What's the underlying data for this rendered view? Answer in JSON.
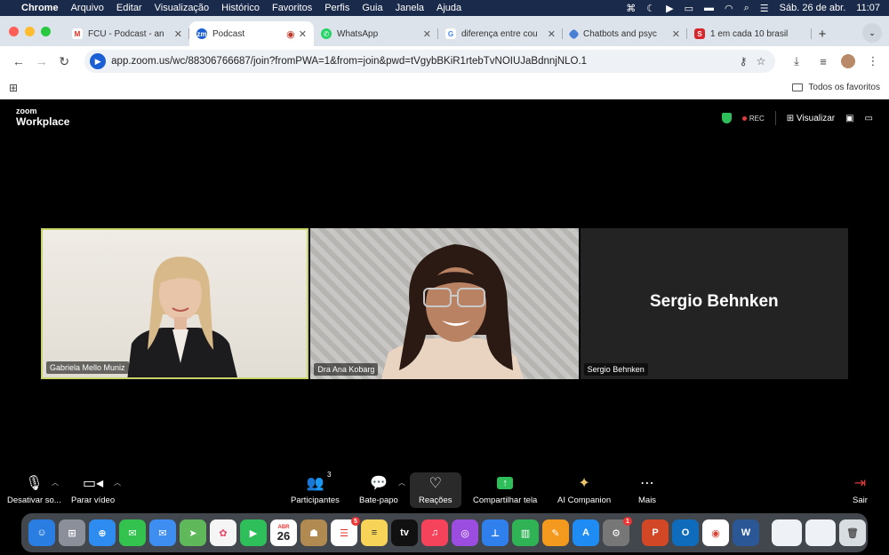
{
  "menubar": {
    "app": "Chrome",
    "items": [
      "Arquivo",
      "Editar",
      "Visualização",
      "Histórico",
      "Favoritos",
      "Perfis",
      "Guia",
      "Janela",
      "Ajuda"
    ],
    "date": "Sáb. 26 de abr.",
    "time": "11:07"
  },
  "tabs": [
    {
      "label": "FCU - Podcast - an",
      "favicon": "gmail-icon",
      "color": "#d93025",
      "active": false
    },
    {
      "label": "Podcast",
      "favicon": "zoom-icon",
      "color": "#1a5fd6",
      "active": true
    },
    {
      "label": "WhatsApp",
      "favicon": "whatsapp-icon",
      "color": "#25d366",
      "active": false
    },
    {
      "label": "diferença entre cou",
      "favicon": "google-icon",
      "color": "#4285f4",
      "active": false
    },
    {
      "label": "Chatbots and psyc",
      "favicon": "site-icon",
      "color": "#4a7fd6",
      "active": false
    },
    {
      "label": "1 em cada 10 brasil",
      "favicon": "site-icon",
      "color": "#d9262c",
      "active": false
    }
  ],
  "address": {
    "url": "app.zoom.us/wc/88306766687/join?fromPWA=1&from=join&pwd=tVgybBKiR1rtebTvNOIUJaBdnnjNLO.1"
  },
  "bookmarks": {
    "all_favorites": "Todos os favoritos"
  },
  "zoom": {
    "logo_top": "zoom",
    "logo_bottom": "Workplace",
    "rec": "REC",
    "view": "Visualizar"
  },
  "participants": [
    {
      "name": "Gabriela Mello Muniz"
    },
    {
      "name": "Dra Ana Kobarg"
    },
    {
      "name": "Sergio Behnken",
      "display": "Sergio Behnken"
    }
  ],
  "controls": {
    "mute": "Desativar so...",
    "video": "Parar vídeo",
    "participants": "Participantes",
    "participants_count": "3",
    "chat": "Bate-papo",
    "reactions": "Reações",
    "share": "Compartilhar tela",
    "ai": "AI Companion",
    "more": "Mais",
    "leave": "Sair"
  },
  "dock": {
    "calendar_month": "ABR",
    "calendar_day": "26",
    "reminders_badge": "5",
    "settings_badge": "1"
  },
  "colors": {
    "accent": "#1a5fd6",
    "share_green": "#2fbf5a",
    "speaker_border": "#c8d36a",
    "rec_red": "#e23b3b"
  }
}
